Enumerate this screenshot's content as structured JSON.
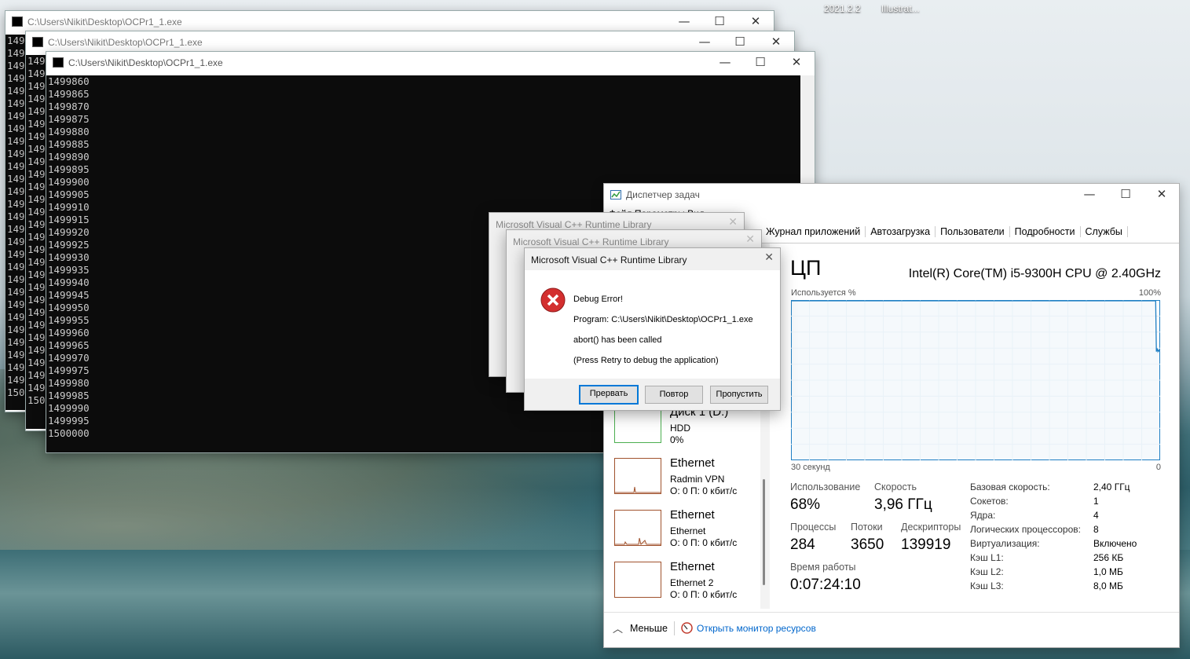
{
  "desktop": {
    "label1": "2021.2.2",
    "label2": "Illustrat..."
  },
  "console_windows": [
    {
      "title": "C:\\Users\\Nikit\\Desktop\\OCPr1_1.exe",
      "lines": [
        "1499",
        "1499",
        "1499",
        "1499",
        "1499",
        "1499",
        "1499",
        "1499",
        "1499",
        "1499",
        "1499",
        "1499",
        "1499",
        "1499",
        "1499",
        "1499",
        "1499",
        "1499",
        "1499",
        "1499",
        "1499",
        "1499",
        "1499",
        "1499",
        "1499",
        "1499",
        "1499",
        "1499",
        "150"
      ]
    },
    {
      "title": "C:\\Users\\Nikit\\Desktop\\OCPr1_1.exe",
      "lines": [
        "1499",
        "1499",
        "1499",
        "1499",
        "1499",
        "1499",
        "1499",
        "1499",
        "1499",
        "1499",
        "1499",
        "1499",
        "1499",
        "1499",
        "1499",
        "1499",
        "1499",
        "1499",
        "1499",
        "1499",
        "1499",
        "1499",
        "1499",
        "1499",
        "1499",
        "1499",
        "1499",
        "150"
      ]
    },
    {
      "title": "C:\\Users\\Nikit\\Desktop\\OCPr1_1.exe",
      "lines": [
        "1499860",
        "1499865",
        "1499870",
        "1499875",
        "1499880",
        "1499885",
        "1499890",
        "1499895",
        "1499900",
        "1499905",
        "1499910",
        "1499915",
        "1499920",
        "1499925",
        "1499930",
        "1499935",
        "1499940",
        "1499945",
        "1499950",
        "1499955",
        "1499960",
        "1499965",
        "1499970",
        "1499975",
        "1499980",
        "1499985",
        "1499990",
        "1499995",
        "1500000"
      ]
    }
  ],
  "window_controls": {
    "minimize": "—",
    "maximize": "☐",
    "close": "✕"
  },
  "dialogs": {
    "back_title1": "Microsoft Visual C++ Runtime Library",
    "back_title2": "Microsoft Visual C++ Runtime Library",
    "title": "Microsoft Visual C++ Runtime Library",
    "heading": "Debug Error!",
    "program": "Program: C:\\Users\\Nikit\\Desktop\\OCPr1_1.exe",
    "message": "abort() has been called",
    "hint": "(Press Retry to debug the application)",
    "btn_abort": "Прервать",
    "btn_retry": "Повтор",
    "btn_ignore": "Пропустить"
  },
  "taskmgr": {
    "title": "Диспетчер задач",
    "menu_partial": "Файл  Параметры  Вид",
    "tabs": [
      "Журнал приложений",
      "Автозагрузка",
      "Пользователи",
      "Подробности",
      "Службы"
    ],
    "side": [
      {
        "h": "Диск 1 (D:)",
        "s1": "HDD",
        "s2": "0%"
      },
      {
        "h": "Ethernet",
        "s1": "Radmin VPN",
        "s2": "О: 0 П: 0 кбит/с"
      },
      {
        "h": "Ethernet",
        "s1": "Ethernet",
        "s2": "О: 0 П: 0 кбит/с"
      },
      {
        "h": "Ethernet",
        "s1": "Ethernet 2",
        "s2": "О: 0 П: 0 кбит/с"
      }
    ],
    "cpu_title": "ЦП",
    "cpu_name": "Intel(R) Core(TM) i5-9300H CPU @ 2.40GHz",
    "used_label": "Используется %",
    "max_label": "100%",
    "time_label": "30 секунд",
    "zero_label": "0",
    "usage_label": "Использование",
    "usage_value": "68%",
    "speed_label": "Скорость",
    "speed_value": "3,96 ГГц",
    "proc_label": "Процессы",
    "proc_value": "284",
    "threads_label": "Потоки",
    "threads_value": "3650",
    "handles_label": "Дескрипторы",
    "handles_value": "139919",
    "uptime_label": "Время работы",
    "uptime_value": "0:07:24:10",
    "specs": [
      {
        "k": "Базовая скорость:",
        "v": "2,40 ГГц"
      },
      {
        "k": "Сокетов:",
        "v": "1"
      },
      {
        "k": "Ядра:",
        "v": "4"
      },
      {
        "k": "Логических процессоров:",
        "v": "8"
      },
      {
        "k": "Виртуализация:",
        "v": "Включено"
      },
      {
        "k": "Кэш L1:",
        "v": "256 КБ"
      },
      {
        "k": "Кэш L2:",
        "v": "1,0 МБ"
      },
      {
        "k": "Кэш L3:",
        "v": "8,0 МБ"
      }
    ],
    "less_label": "Меньше",
    "monitor_link": "Открыть монитор ресурсов",
    "cpu_usage_series": [
      100,
      100,
      100,
      100,
      100,
      100,
      100,
      100,
      100,
      100,
      100,
      100,
      100,
      100,
      100,
      100,
      100,
      100,
      100,
      100,
      100,
      100,
      100,
      100,
      100,
      100,
      100,
      100,
      100,
      100,
      100,
      100,
      100,
      100,
      100,
      100,
      100,
      100,
      100,
      100,
      100,
      100,
      100,
      100,
      100,
      100,
      100,
      100,
      100,
      100,
      100,
      100,
      100,
      100,
      100,
      100,
      100,
      100,
      100,
      100,
      100,
      100,
      100,
      100,
      100,
      100,
      100,
      100,
      100,
      100,
      100,
      100,
      100,
      100,
      100,
      100,
      100,
      100,
      100,
      100,
      100,
      100,
      100,
      100,
      100,
      100,
      100,
      100,
      100,
      100,
      100,
      100,
      100,
      100,
      100,
      100,
      100,
      100,
      100,
      100,
      100,
      100,
      100,
      100,
      100,
      100,
      100,
      100,
      100,
      100,
      100,
      100,
      100,
      100,
      100,
      100,
      100,
      100,
      100,
      100,
      100,
      100,
      100,
      100,
      100,
      100,
      100,
      100,
      100,
      100,
      100,
      100,
      100,
      100,
      100,
      100,
      100,
      100,
      100,
      100,
      100,
      100,
      100,
      100,
      100,
      100,
      100,
      100,
      100,
      100,
      100,
      100,
      100,
      100,
      100,
      100,
      100,
      100,
      100,
      100,
      100,
      100,
      100,
      100,
      100,
      100,
      100,
      100,
      100,
      100,
      100,
      100,
      100,
      100,
      100,
      100,
      100,
      100,
      100,
      100,
      100,
      100,
      100,
      100,
      100,
      100,
      100,
      100,
      100,
      100,
      100,
      100,
      100,
      100,
      100,
      100,
      100,
      100,
      100,
      100,
      100,
      100,
      100,
      100,
      100,
      100,
      100,
      100,
      100,
      100,
      100,
      100,
      100,
      100,
      100,
      100,
      100,
      100,
      100,
      100,
      100,
      100,
      100,
      100,
      100,
      100,
      100,
      100,
      100,
      100,
      100,
      100,
      100,
      100,
      100,
      100,
      100,
      100,
      100,
      100,
      100,
      100,
      100,
      100,
      100,
      100,
      100,
      100,
      100,
      100,
      100,
      100,
      100,
      100,
      100,
      100,
      100,
      100,
      100,
      100,
      100,
      100,
      100,
      100,
      100,
      100,
      100,
      100,
      100,
      100,
      100,
      100,
      100,
      100,
      100,
      100,
      100,
      100,
      100,
      100,
      100,
      100,
      100,
      100,
      100,
      100,
      100,
      100,
      100,
      100,
      100,
      100,
      100,
      100,
      100,
      100,
      100,
      100,
      100,
      100,
      100,
      100,
      100,
      100,
      100,
      100,
      100,
      100,
      100,
      100,
      100,
      100,
      100,
      100,
      100,
      100,
      100,
      100,
      100,
      100,
      100,
      100,
      100,
      100,
      100,
      100,
      100,
      100,
      100,
      100,
      100,
      100,
      100,
      100,
      100,
      100,
      100,
      100,
      100,
      100,
      100,
      100,
      100,
      100,
      100,
      100,
      100,
      100,
      100,
      100,
      100,
      100,
      100,
      100,
      100,
      100,
      100,
      100,
      100,
      100,
      100,
      100,
      100,
      100,
      100,
      100,
      100,
      100,
      100,
      100,
      100,
      100,
      100,
      100,
      100,
      100,
      100,
      100,
      100,
      100,
      100,
      100,
      100,
      100,
      100,
      100,
      100,
      100,
      100,
      100,
      100,
      100,
      100,
      100,
      100,
      100,
      100,
      100,
      100,
      100,
      100,
      100,
      100,
      100,
      100,
      100,
      100,
      100,
      100,
      100,
      100,
      100,
      100,
      100,
      100,
      100,
      100,
      100,
      100,
      100,
      100,
      100,
      100,
      100,
      100,
      100,
      100,
      100,
      100,
      100,
      100,
      100,
      100,
      100,
      100,
      100,
      100,
      100,
      100,
      100,
      100,
      100,
      100,
      100,
      100,
      100,
      100,
      100,
      100,
      100,
      100,
      100,
      100,
      100,
      100,
      100,
      100,
      100,
      100,
      100,
      100,
      100,
      100,
      100,
      100,
      100,
      100,
      100,
      100,
      100,
      100,
      100,
      100,
      100,
      100,
      100,
      100,
      100,
      100,
      100,
      100,
      100,
      100,
      100,
      100,
      100,
      100,
      100,
      100,
      100,
      100,
      68,
      70,
      68,
      69,
      68
    ]
  },
  "colors": {
    "cpu_line": "#1f7fc4",
    "cpu_fill": "#f1f6fb",
    "grid": "#d8e6f0",
    "error_red": "#d32f2f",
    "link_blue": "#0066cc",
    "disk_border": "#4caf50",
    "eth_border": "#a0522d"
  }
}
